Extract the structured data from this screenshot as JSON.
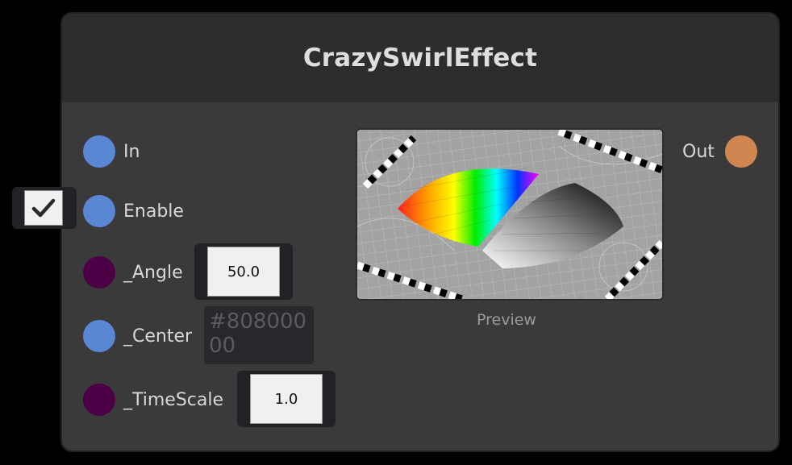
{
  "node": {
    "title": "CrazySwirlEffect",
    "inputs": [
      {
        "label": "In"
      },
      {
        "label": "Enable",
        "checked": true
      },
      {
        "label": "_Angle",
        "value": "50.0"
      },
      {
        "label": "_Center",
        "value": "#80800000"
      },
      {
        "label": "_TimeScale",
        "value": "1.0"
      }
    ],
    "outputs": [
      {
        "label": "Out"
      }
    ],
    "preview_label": "Preview"
  },
  "colors": {
    "port_blue": "#5a87d4",
    "port_purple": "#4c0046",
    "port_orange": "#d08650",
    "node_bg": "#3a3a3a",
    "header_bg": "#2d2d2d"
  },
  "icons": {
    "checkbox": "checkmark-icon"
  }
}
